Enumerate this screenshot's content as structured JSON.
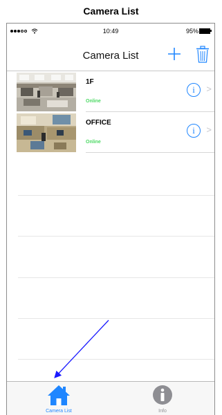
{
  "doc_title": "Camera List",
  "status_bar": {
    "time": "10:49",
    "battery": "95%"
  },
  "nav": {
    "title": "Camera List",
    "add_icon": "plus-icon",
    "delete_icon": "trash-icon"
  },
  "cameras": [
    {
      "name": "1F",
      "status": "Online"
    },
    {
      "name": "OFFICE",
      "status": "Online"
    }
  ],
  "tabs": [
    {
      "label": "Camera List",
      "icon": "house-icon",
      "active": true
    },
    {
      "label": "Info",
      "icon": "info-icon",
      "active": false
    }
  ],
  "colors": {
    "accent": "#1f86ff",
    "online": "#4cd964",
    "inactive": "#8e8e93",
    "annotation_arrow": "#1a1aff"
  }
}
